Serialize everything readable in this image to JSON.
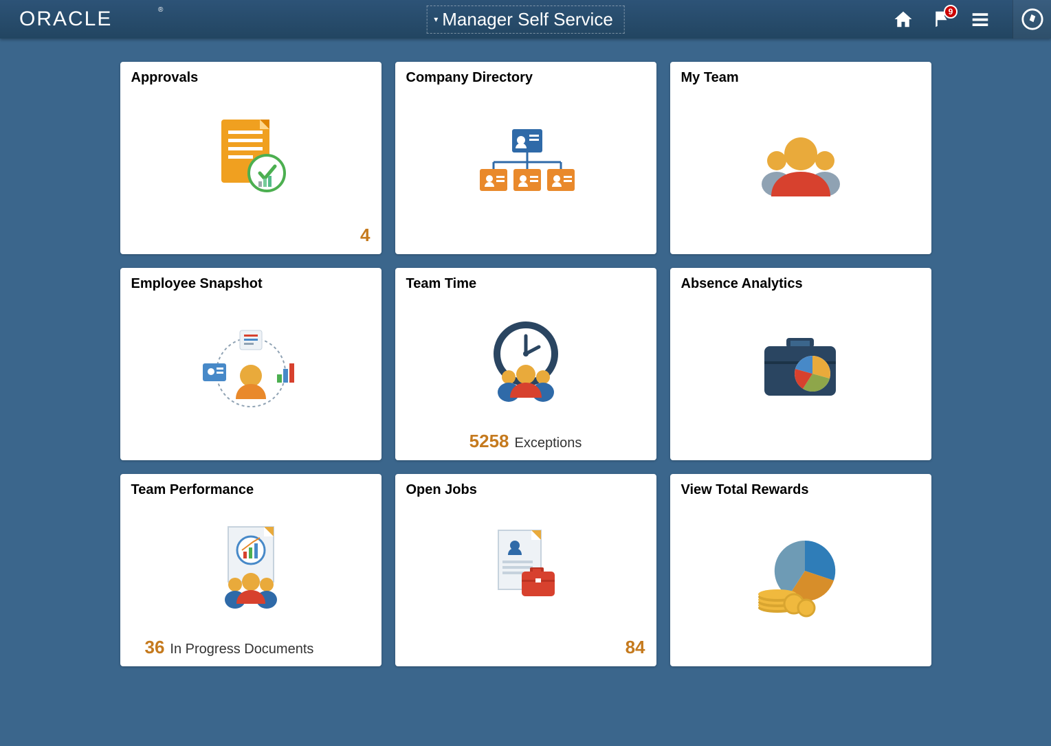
{
  "header": {
    "logo_text": "ORACLE",
    "dropdown_label": "Manager Self Service",
    "notification_count": "9"
  },
  "tiles": [
    {
      "title": "Approvals",
      "count": "4",
      "count_label": "",
      "footer_align": "right"
    },
    {
      "title": "Company Directory"
    },
    {
      "title": "My Team"
    },
    {
      "title": "Employee Snapshot"
    },
    {
      "title": "Team Time",
      "count": "5258",
      "count_label": "Exceptions",
      "footer_align": "center"
    },
    {
      "title": "Absence Analytics"
    },
    {
      "title": "Team Performance",
      "count": "36",
      "count_label": "In Progress Documents",
      "footer_align": "left"
    },
    {
      "title": "Open Jobs",
      "count": "84",
      "count_label": "",
      "footer_align": "right"
    },
    {
      "title": "View Total Rewards"
    }
  ]
}
